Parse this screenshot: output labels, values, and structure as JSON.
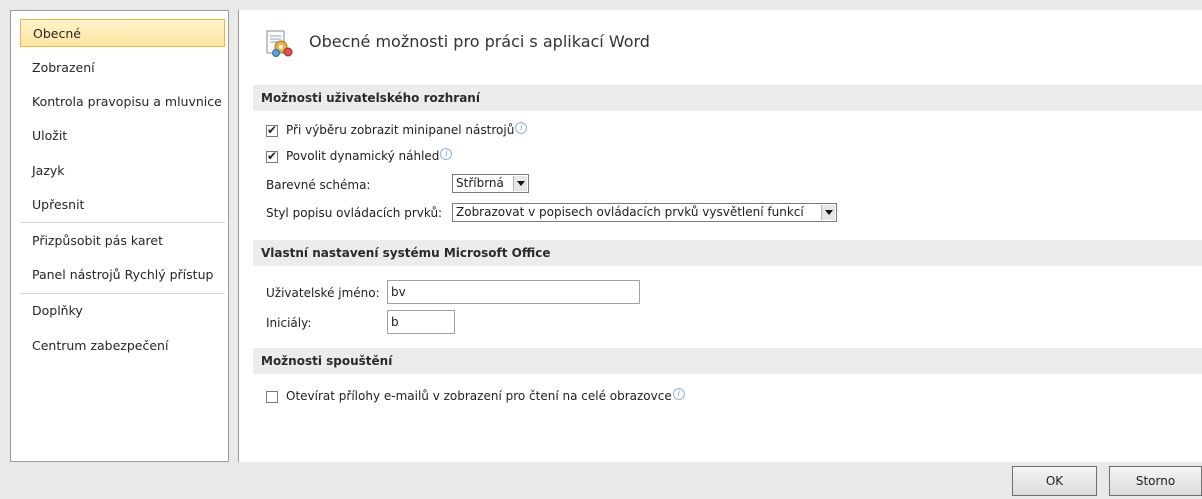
{
  "sidebar": {
    "items": [
      {
        "label": "Obecné",
        "active": true
      },
      {
        "label": "Zobrazení"
      },
      {
        "label": "Kontrola pravopisu a mluvnice"
      },
      {
        "label": "Uložit"
      },
      {
        "label": "Jazyk"
      },
      {
        "label": "Upřesnit"
      },
      {
        "label": "Přizpůsobit pás karet"
      },
      {
        "label": "Panel nástrojů Rychlý přístup"
      },
      {
        "label": "Doplňky"
      },
      {
        "label": "Centrum zabezpečení"
      }
    ]
  },
  "page": {
    "title": "Obecné možnosti pro práci s aplikací Word",
    "icon": "options-general-icon"
  },
  "ui_options": {
    "heading": "Možnosti uživatelského rozhraní",
    "minibar": {
      "label": "Při výběru zobrazit minipanel nástrojů",
      "checked": true
    },
    "live_preview": {
      "label": "Povolit dynamický náhled",
      "checked": true
    },
    "color_scheme": {
      "label": "Barevné schéma:",
      "value": "Stříbrná"
    },
    "tooltip_style": {
      "label": "Styl popisu ovládacích prvků:",
      "value": "Zobrazovat v popisech ovládacích prvků vysvětlení funkcí"
    }
  },
  "personalize": {
    "heading": "Vlastní nastavení systému Microsoft Office",
    "username": {
      "label": "Uživatelské jméno:",
      "value": "bv"
    },
    "initials": {
      "label": "Iniciály:",
      "value": "b"
    }
  },
  "startup": {
    "heading": "Možnosti spouštění",
    "open_attachments": {
      "label": "Otevírat přílohy e-mailů v zobrazení pro čtení na celé obrazovce",
      "checked": false
    }
  },
  "buttons": {
    "ok": "OK",
    "cancel": "Storno"
  },
  "colors": {
    "active_item_bg": "#fde5a1",
    "active_item_border": "#e9b54c",
    "section_bg": "#ececec"
  }
}
